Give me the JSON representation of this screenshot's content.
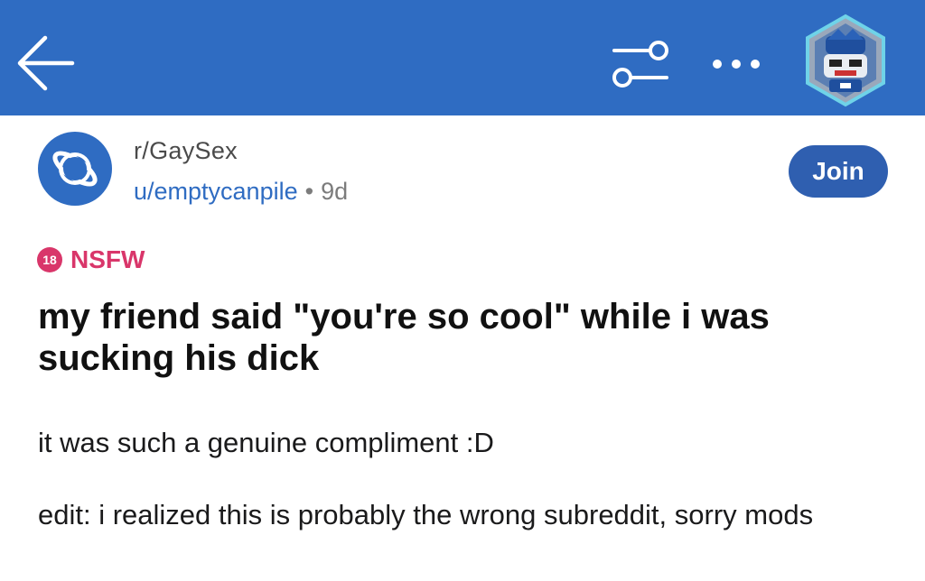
{
  "header": {
    "background": "#2f6cc2",
    "back_icon": "back-arrow-icon",
    "filter_icon": "sliders-icon",
    "more_icon": "more-dots-icon"
  },
  "post": {
    "subreddit": "r/GaySex",
    "user": "u/emptycanpile",
    "separator": "•",
    "age": "9d",
    "join_label": "Join",
    "nsfw_age": "18",
    "nsfw_label": "NSFW",
    "title": "my friend said \"you're so cool\" while i was sucking his dick",
    "body": [
      "it was such a genuine compliment :D",
      "edit: i realized this is probably the wrong subreddit, sorry mods"
    ]
  },
  "colors": {
    "accent": "#2f6cc2",
    "join": "#2f5fb0",
    "nsfw": "#d9366a"
  }
}
